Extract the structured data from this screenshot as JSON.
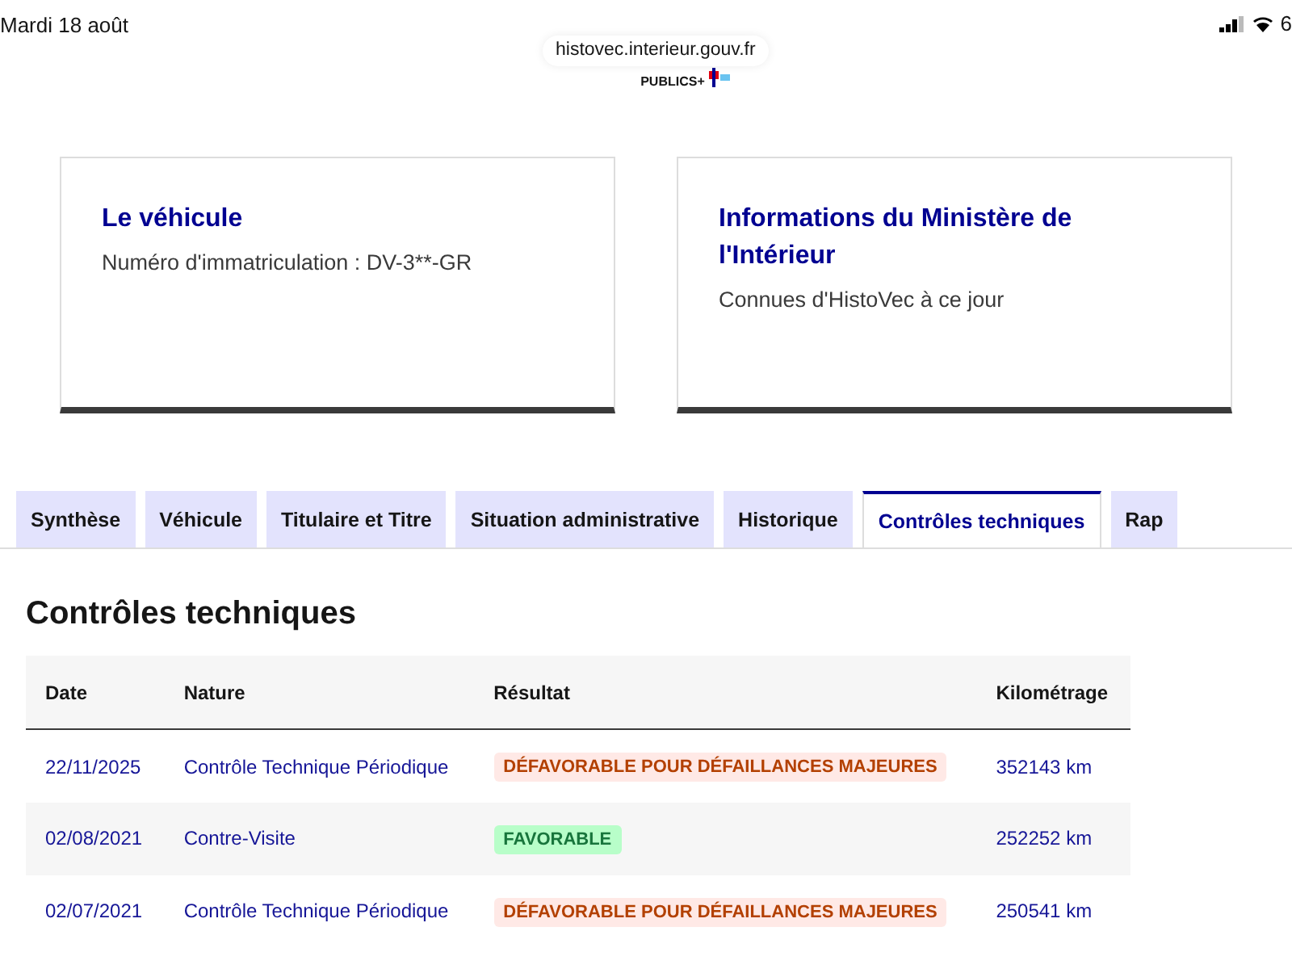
{
  "status_bar": {
    "date": "Mardi 18 août",
    "url": "histovec.interieur.gouv.fr",
    "battery": "6"
  },
  "logo": {
    "text": "PUBLICS+"
  },
  "cards": [
    {
      "title": "Le véhicule",
      "text": "Numéro d'immatriculation : DV-3**-GR"
    },
    {
      "title": "Informations du Ministère de l'Intérieur",
      "text": "Connues d'HistoVec à ce jour"
    }
  ],
  "tabs": [
    {
      "label": "Synthèse",
      "selected": false
    },
    {
      "label": "Véhicule",
      "selected": false
    },
    {
      "label": "Titulaire et Titre",
      "selected": false
    },
    {
      "label": "Situation administrative",
      "selected": false
    },
    {
      "label": "Historique",
      "selected": false
    },
    {
      "label": "Contrôles techniques",
      "selected": true
    },
    {
      "label": "Rap",
      "selected": false
    }
  ],
  "section": {
    "title": "Contrôles techniques"
  },
  "table": {
    "columns": [
      "Date",
      "Nature",
      "Résultat",
      "Kilométrage"
    ],
    "rows": [
      {
        "date": "22/11/2025",
        "nature": "Contrôle Technique Périodique",
        "result": {
          "kind": "unfavorable",
          "label": "DÉFAVORABLE POUR DÉFAILLANCES MAJEURES"
        },
        "mileage": "352143 km"
      },
      {
        "date": "02/08/2021",
        "nature": "Contre-Visite",
        "result": {
          "kind": "favorable",
          "label": "FAVORABLE"
        },
        "mileage": "252252 km"
      },
      {
        "date": "02/07/2021",
        "nature": "Contrôle Technique Périodique",
        "result": {
          "kind": "unfavorable",
          "label": "DÉFAVORABLE POUR DÉFAILLANCES MAJEURES"
        },
        "mileage": "250541 km"
      }
    ]
  }
}
